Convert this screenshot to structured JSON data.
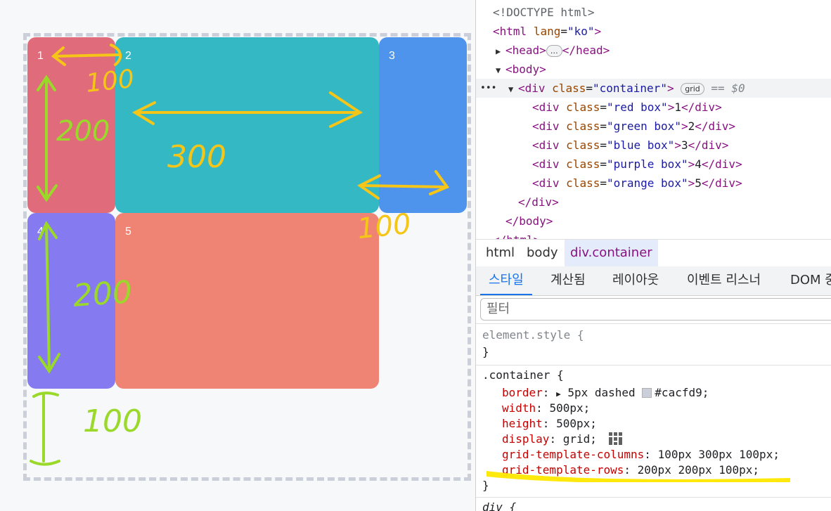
{
  "boxes": [
    {
      "label": "1",
      "color": "#e06b7a"
    },
    {
      "label": "2",
      "color": "#34b9c4"
    },
    {
      "label": "3",
      "color": "#4e94ec"
    },
    {
      "label": "4",
      "color": "#857af0"
    },
    {
      "label": "5",
      "color": "#f08474"
    }
  ],
  "annotations": [
    "100",
    "200",
    "300",
    "100",
    "200",
    "100"
  ],
  "dom_tree": {
    "doctype": "<!DOCTYPE html>",
    "html_open": "<html",
    "html_attr": "lang",
    "html_val": "\"ko\"",
    "html_close": ">",
    "head_open": "<head>",
    "head_ellipsis": "…",
    "head_close": "</head>",
    "body_open": "<body>",
    "div_open": "<div",
    "div_attr": "class",
    "div_val": "\"container\"",
    "div_gt": ">",
    "grid_badge": "grid",
    "selected_marker": "== $0",
    "children": [
      {
        "open": "<div",
        "attr": "class",
        "val": "\"red box\"",
        "gt": ">",
        "text": "1",
        "close": "</div>"
      },
      {
        "open": "<div",
        "attr": "class",
        "val": "\"green box\"",
        "gt": ">",
        "text": "2",
        "close": "</div>"
      },
      {
        "open": "<div",
        "attr": "class",
        "val": "\"blue box\"",
        "gt": ">",
        "text": "3",
        "close": "</div>"
      },
      {
        "open": "<div",
        "attr": "class",
        "val": "\"purple box\"",
        "gt": ">",
        "text": "4",
        "close": "</div>"
      },
      {
        "open": "<div",
        "attr": "class",
        "val": "\"orange box\"",
        "gt": ">",
        "text": "5",
        "close": "</div>"
      }
    ],
    "div_close": "</div>",
    "body_close": "</body>",
    "html_close_tag": "</html>"
  },
  "breadcrumbs": [
    "html",
    "body",
    "div.container"
  ],
  "tabs": [
    "스타일",
    "계산됨",
    "레이아웃",
    "이벤트 리스너",
    "DOM 중"
  ],
  "filter_placeholder": "필터",
  "styles": {
    "element_style": "element.style {",
    "close_brace": "}",
    "container_selector": ".container {",
    "rules": [
      {
        "prop": "border",
        "value": "5px dashed",
        "color": "#cacfd9"
      },
      {
        "prop": "width",
        "value": "500px;"
      },
      {
        "prop": "height",
        "value": "500px;"
      },
      {
        "prop": "display",
        "value": "grid;"
      },
      {
        "prop": "grid-template-columns",
        "value": "100px 300px 100px;"
      },
      {
        "prop": "grid-template-rows",
        "value": "200px 200px 100px;"
      }
    ],
    "color_text": "#cacfd9;",
    "next_selector": "div {"
  },
  "highlight_color": "#ffe800",
  "annotation_colors": {
    "orange": "#f5c518",
    "green": "#9ad82a"
  }
}
